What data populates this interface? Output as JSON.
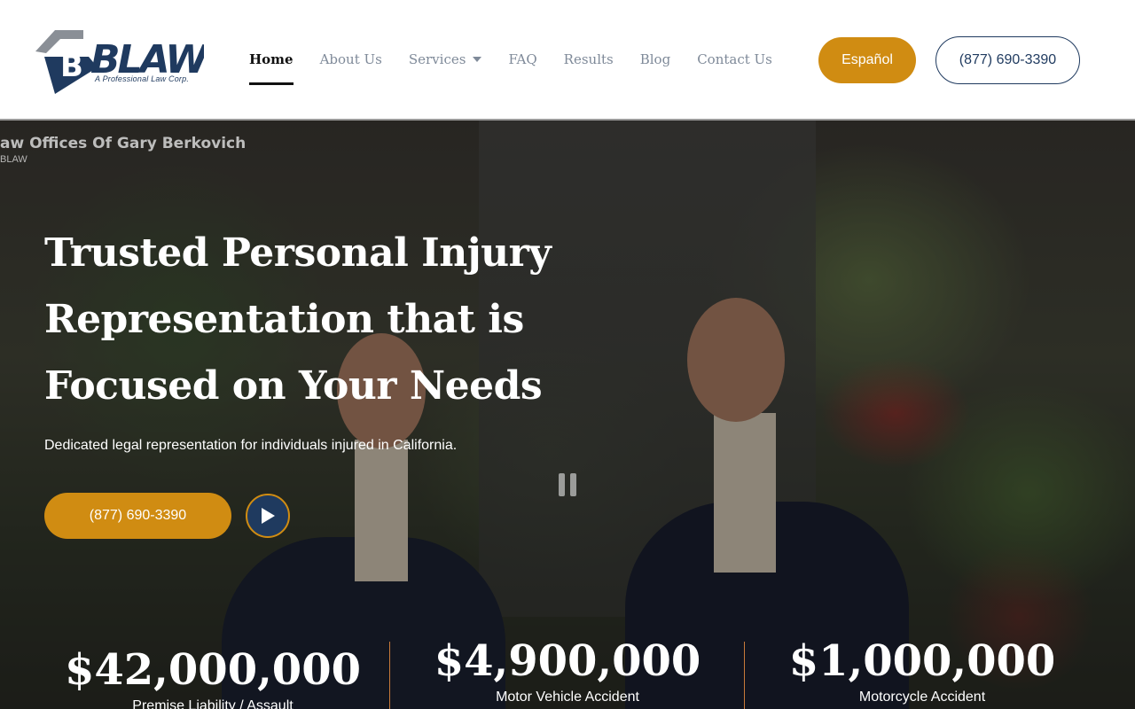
{
  "logo": {
    "text": "BLAW",
    "tagline": "A Professional Law Corp."
  },
  "nav": {
    "items": [
      {
        "label": "Home",
        "active": true
      },
      {
        "label": "About Us"
      },
      {
        "label": "Services",
        "has_dropdown": true
      },
      {
        "label": "FAQ"
      },
      {
        "label": "Results"
      },
      {
        "label": "Blog"
      },
      {
        "label": "Contact Us"
      }
    ]
  },
  "header": {
    "language_button": "Español",
    "phone_button": "(877) 690-3390"
  },
  "video": {
    "title": "aw Offices Of Gary Berkovich",
    "channel": "BLAW"
  },
  "hero": {
    "title": "Trusted Personal Injury Representation that is Focused on Your Needs",
    "subtitle": "Dedicated legal representation for individuals injured in California.",
    "phone_button": "(877) 690-3390"
  },
  "stats": [
    {
      "value": "$42,000,000",
      "label": "Premise Liability / Assault"
    },
    {
      "value": "$4,900,000",
      "label": "Motor Vehicle Accident"
    },
    {
      "value": "$1,000,000",
      "label": "Motorcycle Accident"
    }
  ],
  "colors": {
    "accent": "#d08c12",
    "navy": "#1f3a5f",
    "nav_text": "#7f8a99"
  }
}
